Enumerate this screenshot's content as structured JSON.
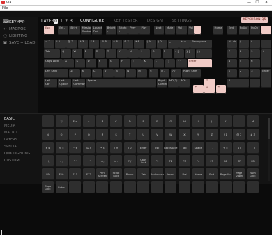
{
  "window": {
    "title": "via",
    "menu": "File",
    "min": "—",
    "max": "☐",
    "close": "✕"
  },
  "topnav": [
    "CONFIGURE",
    "KEY TESTER",
    "DESIGN",
    "SETTINGS"
  ],
  "sidebar": [
    {
      "label": "KEYMAP",
      "icon": "keyboard-icon"
    },
    {
      "label": "MACROS",
      "icon": "code-icon"
    },
    {
      "label": "LIGHTING",
      "icon": "bulb-icon"
    },
    {
      "label": "SAVE + LOAD",
      "icon": "save-icon"
    }
  ],
  "layer": {
    "label": "LAYER",
    "buttons": [
      "0",
      "1",
      "2",
      "3"
    ],
    "selected": "0"
  },
  "device_badge": "KEYCHRON Q5",
  "keyboard_rows": [
    [
      {
        "l": "Esc",
        "hl": true
      },
      {
        "l": "Bri -"
      },
      {
        "l": "Bri +"
      },
      {
        "l": "Mission Control"
      },
      {
        "l": "Launch Pad"
      },
      {
        "l": "Bright -"
      },
      {
        "l": "Bright +"
      },
      {
        "l": "Prev"
      },
      {
        "l": "Play"
      },
      {
        "l": "Next"
      },
      {
        "l": "Mute"
      },
      {
        "l": "Vol -"
      },
      {
        "l": "Vol +"
      },
      {
        "l": "",
        "hl": true
      },
      {
        "l": "Home"
      },
      {
        "l": "End"
      },
      {
        "l": "PgUp"
      },
      {
        "l": "PgDn"
      },
      {
        "l": "",
        "hl": true
      }
    ],
    [
      {
        "l": "~ `"
      },
      {
        "l": "! 1"
      },
      {
        "l": "@ 2"
      },
      {
        "l": "# 3"
      },
      {
        "l": "$ 4"
      },
      {
        "l": "% 5"
      },
      {
        "l": "^ 6"
      },
      {
        "l": "& 7"
      },
      {
        "l": "* 8"
      },
      {
        "l": "( 9"
      },
      {
        "l": ") 0"
      },
      {
        "l": "_ -"
      },
      {
        "l": "+ ="
      },
      {
        "l": "Backspace"
      },
      {
        "l": "N-Lck"
      },
      {
        "l": "/"
      },
      {
        "l": "*"
      },
      {
        "l": "-"
      }
    ],
    [
      {
        "l": "Tab"
      },
      {
        "l": "Q"
      },
      {
        "l": "W"
      },
      {
        "l": "E"
      },
      {
        "l": "R"
      },
      {
        "l": "T"
      },
      {
        "l": "Y"
      },
      {
        "l": "U"
      },
      {
        "l": "I"
      },
      {
        "l": "O"
      },
      {
        "l": "P"
      },
      {
        "l": "{ ["
      },
      {
        "l": "} ]"
      },
      {
        "l": "| \\"
      },
      {
        "l": "7"
      },
      {
        "l": "8"
      },
      {
        "l": "9"
      },
      {
        "l": "+"
      }
    ],
    [
      {
        "l": "Caps Lock"
      },
      {
        "l": "A"
      },
      {
        "l": "S"
      },
      {
        "l": "D"
      },
      {
        "l": "F"
      },
      {
        "l": "G"
      },
      {
        "l": "H"
      },
      {
        "l": "J"
      },
      {
        "l": "K"
      },
      {
        "l": "L"
      },
      {
        "l": ": ;"
      },
      {
        "l": "\" '"
      },
      {
        "l": "Enter",
        "hl": true
      },
      {
        "l": "4"
      },
      {
        "l": "5"
      },
      {
        "l": "6"
      }
    ],
    [
      {
        "l": "Left Shift"
      },
      {
        "l": "Z"
      },
      {
        "l": "X"
      },
      {
        "l": "C"
      },
      {
        "l": "V"
      },
      {
        "l": "B"
      },
      {
        "l": "N"
      },
      {
        "l": "M"
      },
      {
        "l": "< ,"
      },
      {
        "l": "> ."
      },
      {
        "l": "? /"
      },
      {
        "l": "Right Shift"
      },
      {
        "l": "↑",
        "hl": true
      },
      {
        "l": "1"
      },
      {
        "l": "2"
      },
      {
        "l": "3"
      },
      {
        "l": "Enter"
      }
    ],
    [
      {
        "l": "Left Ctrl"
      },
      {
        "l": "Left Option"
      },
      {
        "l": "Left Command"
      },
      {
        "l": "Space"
      },
      {
        "l": "Right Command"
      },
      {
        "l": "MO(3)"
      },
      {
        "l": "RCtl"
      },
      {
        "l": "←",
        "hl": true
      },
      {
        "l": "↓",
        "hl": true
      },
      {
        "l": "→",
        "hl": true
      },
      {
        "l": "0"
      },
      {
        "l": "."
      }
    ]
  ],
  "categories": [
    "BASIC",
    "MEDIA",
    "MACRO",
    "LAYERS",
    "SPECIAL",
    "QMK LIGHTING",
    "CUSTOM"
  ],
  "active_category": "BASIC",
  "basic_keys": [
    "",
    "▽",
    "Esc",
    "A",
    "B",
    "C",
    "D",
    "E",
    "F",
    "G",
    "H",
    "I",
    "J",
    "K",
    "L",
    "M",
    "N",
    "O",
    "P",
    "Q",
    "R",
    "S",
    "T",
    "U",
    "V",
    "W",
    "X",
    "Y",
    "Z",
    "! 1",
    "@ 2",
    "# 3",
    "$ 4",
    "% 5",
    "^ 6",
    "& 7",
    "* 8",
    "( 9",
    ") 0",
    "Enter",
    "Esc",
    "Backspace",
    "Tab",
    "Space",
    "_ -",
    "+ =",
    "{ [",
    "} ]",
    "| \\",
    ": ;",
    "\" '",
    "~ `",
    "< ,",
    "> .",
    "? /",
    "Caps Lock",
    "F1",
    "F2",
    "F3",
    "F4",
    "F5",
    "F6",
    "F7",
    "F8",
    "F9",
    "F10",
    "F11",
    "F12",
    "Print Screen",
    "Scroll Lock",
    "Pause",
    "Tab",
    "Backspace",
    "Insert",
    "Del",
    "Home",
    "End",
    "Page Up",
    "Page Down",
    "Num Lock",
    "Caps Lock",
    "Enter",
    "",
    "",
    "",
    "",
    "",
    "",
    "",
    "",
    "",
    "",
    "",
    "",
    "",
    ""
  ]
}
